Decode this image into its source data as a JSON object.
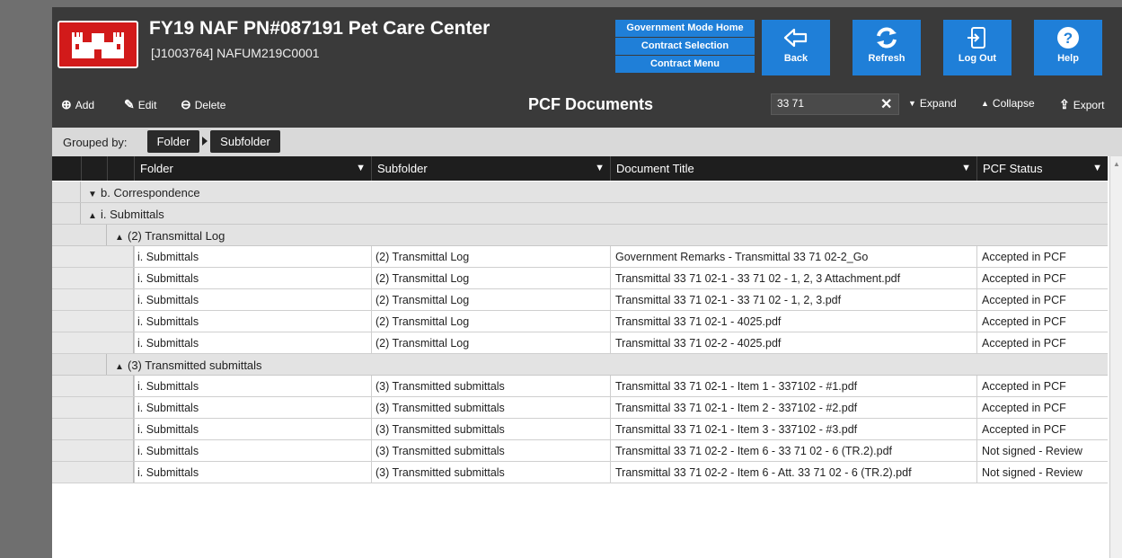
{
  "header": {
    "title": "FY19 NAF PN#087191 Pet Care Center",
    "subtitle": "[J1003764] NAFUM219C0001",
    "gov_menu": [
      "Government Mode Home",
      "Contract Selection",
      "Contract Menu"
    ],
    "buttons": {
      "back": "Back",
      "refresh": "Refresh",
      "logout": "Log Out",
      "help": "Help"
    }
  },
  "toolbar": {
    "add": "Add",
    "edit": "Edit",
    "delete": "Delete",
    "title": "PCF Documents",
    "search_value": "33 71",
    "expand": "Expand",
    "collapse": "Collapse",
    "export": "Export"
  },
  "grouping": {
    "label": "Grouped by:",
    "chips": [
      "Folder",
      "Subfolder"
    ]
  },
  "columns": [
    "Folder",
    "Subfolder",
    "Document Title",
    "PCF Status"
  ],
  "groups": {
    "g1": "b. Correspondence",
    "g2": "i. Submittals",
    "sg1": "(2) Transmittal Log",
    "sg2": "(3) Transmitted submittals"
  },
  "rows1": [
    {
      "folder": "i. Submittals",
      "subfolder": "(2) Transmittal Log",
      "title": "Government Remarks - Transmittal 33 71 02-2_Go",
      "status": "Accepted in PCF"
    },
    {
      "folder": "i. Submittals",
      "subfolder": "(2) Transmittal Log",
      "title": "Transmittal 33 71 02-1 - 33 71 02 - 1, 2, 3 Attachment.pdf",
      "status": "Accepted in PCF"
    },
    {
      "folder": "i. Submittals",
      "subfolder": "(2) Transmittal Log",
      "title": "Transmittal 33 71 02-1 - 33 71 02 - 1, 2, 3.pdf",
      "status": "Accepted in PCF"
    },
    {
      "folder": "i. Submittals",
      "subfolder": "(2) Transmittal Log",
      "title": "Transmittal 33 71 02-1 - 4025.pdf",
      "status": "Accepted in PCF"
    },
    {
      "folder": "i. Submittals",
      "subfolder": "(2) Transmittal Log",
      "title": "Transmittal 33 71 02-2 - 4025.pdf",
      "status": "Accepted in PCF"
    }
  ],
  "rows2": [
    {
      "folder": "i. Submittals",
      "subfolder": "(3) Transmitted submittals",
      "title": "Transmittal 33 71 02-1 - Item 1 - 337102 - #1.pdf",
      "status": "Accepted in PCF"
    },
    {
      "folder": "i. Submittals",
      "subfolder": "(3) Transmitted submittals",
      "title": "Transmittal 33 71 02-1 - Item 2 - 337102 - #2.pdf",
      "status": "Accepted in PCF"
    },
    {
      "folder": "i. Submittals",
      "subfolder": "(3) Transmitted submittals",
      "title": "Transmittal 33 71 02-1 - Item 3 - 337102 - #3.pdf",
      "status": "Accepted in PCF"
    },
    {
      "folder": "i. Submittals",
      "subfolder": "(3) Transmitted submittals",
      "title": "Transmittal 33 71 02-2 - Item 6 - 33 71 02 - 6 (TR.2).pdf",
      "status": "Not signed - Review"
    },
    {
      "folder": "i. Submittals",
      "subfolder": "(3) Transmitted submittals",
      "title": "Transmittal 33 71 02-2 - Item 6 - Att. 33 71 02  - 6 (TR.2).pdf",
      "status": "Not signed - Review"
    }
  ],
  "colors": {
    "accent": "#1f7fd8",
    "logo_red": "#d21a1a",
    "header_bg": "#3a3a3a"
  }
}
